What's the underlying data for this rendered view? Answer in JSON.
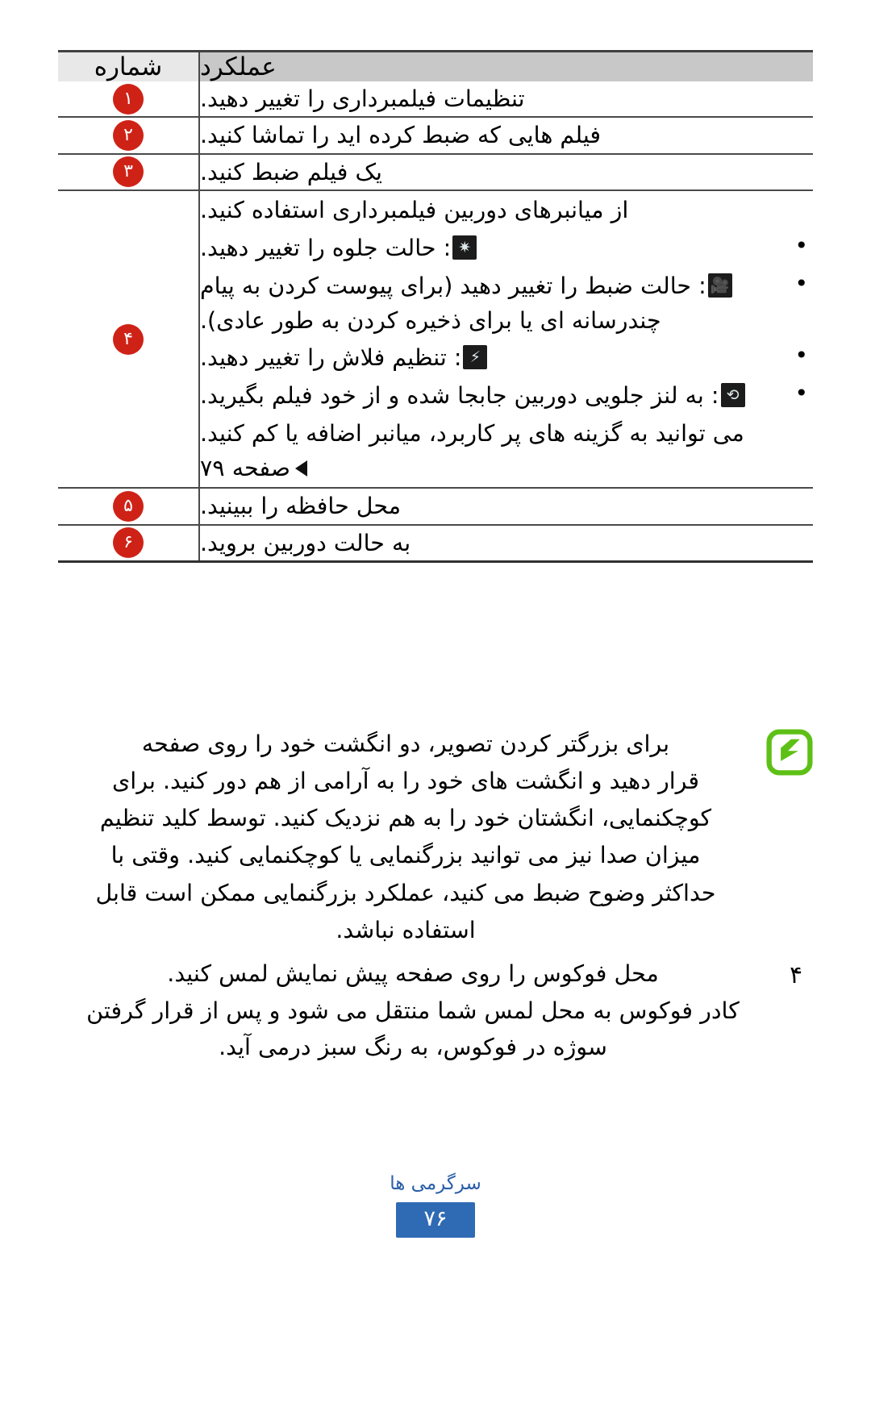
{
  "table": {
    "headers": {
      "number": "شماره",
      "function": "عملکرد"
    },
    "rows": [
      {
        "badge": "۱",
        "text": "تنظیمات فیلمبرداری را تغییر دهید."
      },
      {
        "badge": "۲",
        "text": "فیلم هایی که ضبط کرده اید را تماشا کنید."
      },
      {
        "badge": "۳",
        "text": "یک فیلم ضبط کنید."
      },
      {
        "badge": "۴",
        "intro": "از میانبرهای دوربین فیلمبرداری استفاده کنید.",
        "bullets": [
          {
            "icon": "effect-mode-icon",
            "glyph": "✷",
            "text": ": حالت جلوه را تغییر دهید."
          },
          {
            "icon": "recording-mode-camcorder-icon",
            "glyph": "🎥",
            "text": ": حالت ضبط را تغییر دهید (برای پیوست کردن به پیام چندرسانه ای یا برای ذخیره کردن به طور عادی)."
          },
          {
            "icon": "flash-off-icon",
            "glyph": "⚡",
            "text": ": تنظیم فلاش را تغییر دهید."
          },
          {
            "icon": "switch-camera-icon",
            "glyph": "⟲",
            "text": ": به لنز جلویی دوربین جابجا شده و از خود فیلم بگیرید."
          }
        ],
        "tail": "می توانید به گزینه های پر کاربرد، میانبر اضافه یا کم کنید.",
        "page_ref_label": "صفحه",
        "page_ref_number": "۷۹"
      },
      {
        "badge": "۵",
        "text": "محل حافظه را ببینید."
      },
      {
        "badge": "۶",
        "text": "به حالت دوربین بروید."
      }
    ]
  },
  "note": {
    "icon": "note-pencil-icon",
    "lines": [
      "برای بزرگتر کردن تصویر، دو انگشت خود را روی صفحه",
      "قرار دهید و انگشت های خود را به آرامی از هم دور کنید. برای",
      "کوچکنمایی، انگشتان خود را به هم نزدیک کنید. توسط کلید تنظیم",
      "میزان صدا نیز می توانید بزرگنمایی یا کوچکنمایی کنید. وقتی با",
      "حداکثر وضوح ضبط می کنید، عملکرد بزرگنمایی ممکن است قابل",
      "استفاده نباشد."
    ]
  },
  "step": {
    "number": "۴",
    "lines": [
      "محل فوکوس را روی صفحه پیش نمایش لمس کنید.",
      "کادر فوکوس به محل لمس شما منتقل می شود و پس از قرار گرفتن",
      "سوژه در فوکوس، به رنگ سبز درمی آید."
    ]
  },
  "footer": {
    "section_title": "سرگرمی ها",
    "page_number": "۷۶"
  },
  "colors": {
    "badge_red": "#cf2217",
    "note_green": "#5ec016",
    "footer_blue": "#2f6ab4",
    "header_gray": "#c8c8c8",
    "header_light_gray": "#e8e8e8"
  }
}
